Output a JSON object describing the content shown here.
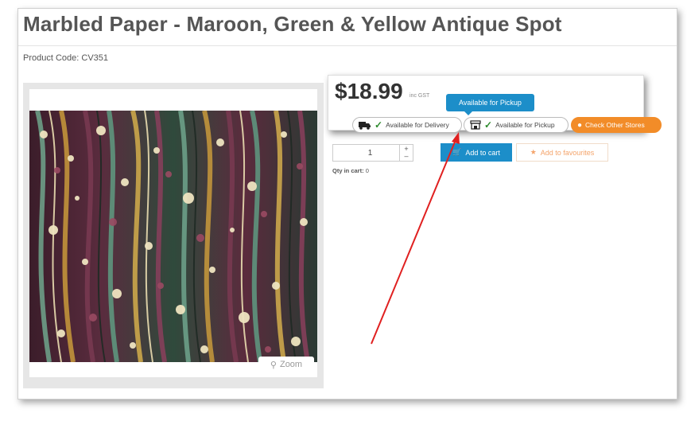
{
  "product": {
    "title": "Marbled Paper - Maroon, Green & Yellow Antique Spot",
    "code_label": "Product Code: CV351",
    "price": "$18.99",
    "gst_note": "inc GST",
    "zoom_label": "Zoom"
  },
  "availability": {
    "delivery_label": "Available for Delivery",
    "pickup_label": "Available for Pickup",
    "other_stores_label": "Check Other Stores",
    "tooltip": "Available for Pickup"
  },
  "cart": {
    "quantity_value": "1",
    "add_to_cart_label": "Add to cart",
    "favourites_label": "Add to favourites",
    "qty_in_cart_label": "Qty in cart:",
    "qty_in_cart_value": "0"
  },
  "colors": {
    "accent_blue": "#1c8ec9",
    "accent_orange": "#f28c28",
    "annotation_arrow": "#e02020",
    "check_green": "#2e8b2e"
  }
}
